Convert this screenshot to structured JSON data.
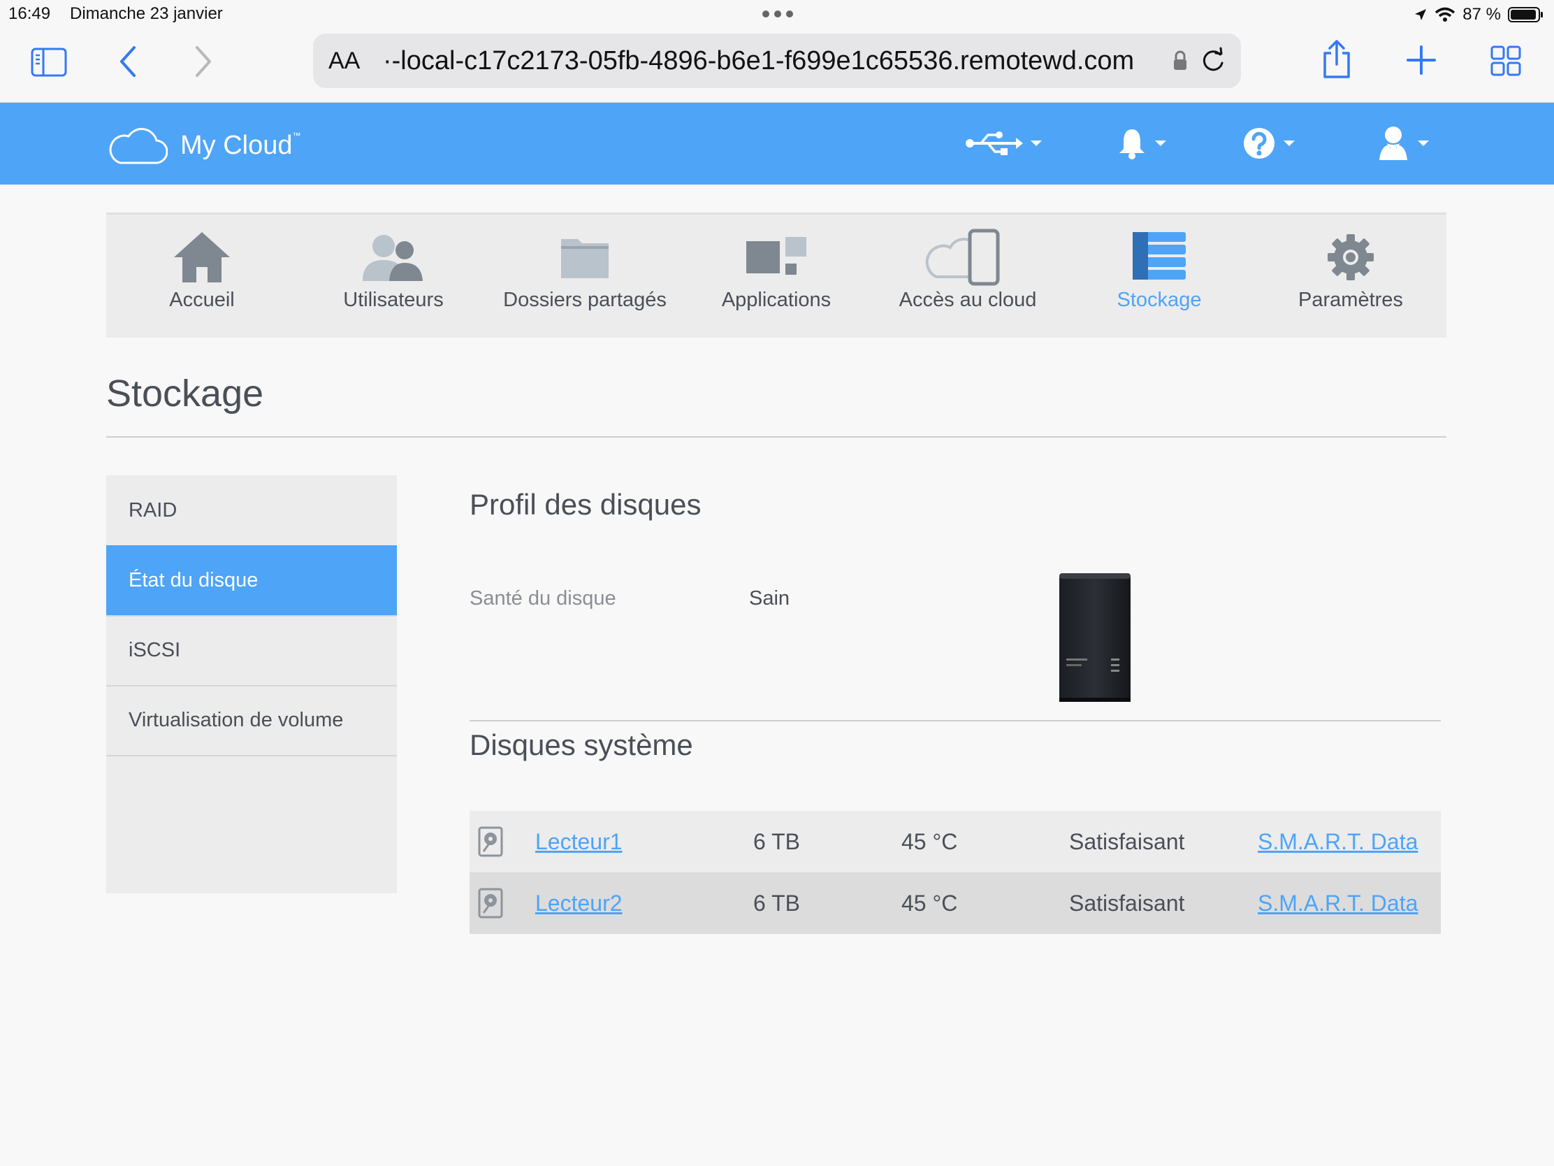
{
  "status": {
    "time": "16:49",
    "date": "Dimanche 23 janvier",
    "battery": "87 %"
  },
  "browser": {
    "aa_label": "AA",
    "url": "·-local-c17c2173-05fb-4896-b6e1-f699e1c65536.remotewd.com"
  },
  "app": {
    "logo_text": "My Cloud",
    "logo_tm": "™",
    "accent": "#4ea4f7"
  },
  "nav": {
    "items": [
      {
        "label": "Accueil",
        "icon": "home-icon"
      },
      {
        "label": "Utilisateurs",
        "icon": "users-icon"
      },
      {
        "label": "Dossiers partagés",
        "icon": "folder-icon"
      },
      {
        "label": "Applications",
        "icon": "apps-icon"
      },
      {
        "label": "Accès au cloud",
        "icon": "cloud-access-icon"
      },
      {
        "label": "Stockage",
        "icon": "storage-icon",
        "active": true
      },
      {
        "label": "Paramètres",
        "icon": "gear-icon"
      }
    ]
  },
  "page": {
    "title": "Stockage"
  },
  "sidebar": {
    "items": [
      {
        "label": "RAID"
      },
      {
        "label": "État du disque",
        "active": true
      },
      {
        "label": "iSCSI"
      },
      {
        "label": "Virtualisation de volume"
      }
    ]
  },
  "profile": {
    "title": "Profil des disques",
    "health_label": "Santé du disque",
    "health_value": "Sain"
  },
  "system_disks": {
    "title": "Disques système",
    "rows": [
      {
        "name": "Lecteur1",
        "size": "6 TB",
        "temp": "45 °C",
        "status": "Satisfaisant",
        "smart": "S.M.A.R.T. Data"
      },
      {
        "name": "Lecteur2",
        "size": "6 TB",
        "temp": "45 °C",
        "status": "Satisfaisant",
        "smart": "S.M.A.R.T. Data"
      }
    ]
  }
}
